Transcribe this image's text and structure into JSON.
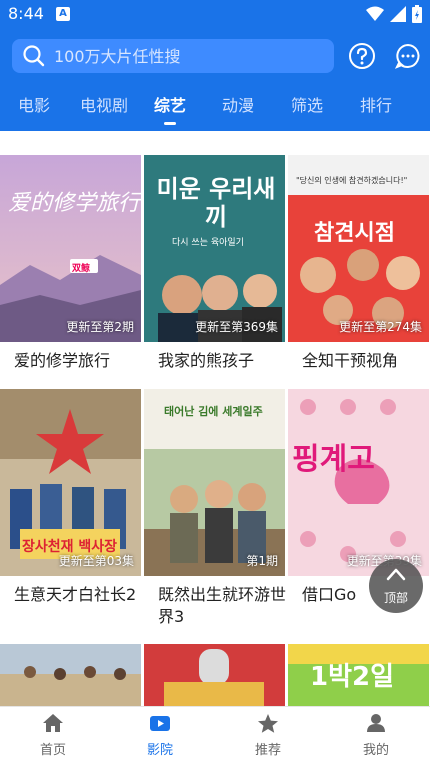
{
  "status": {
    "time": "8:44",
    "notif": "A"
  },
  "search": {
    "placeholder": "100万大片任性搜"
  },
  "tabs": [
    {
      "label": "电影"
    },
    {
      "label": "电视剧"
    },
    {
      "label": "综艺"
    },
    {
      "label": "动漫"
    },
    {
      "label": "筛选"
    },
    {
      "label": "排行"
    }
  ],
  "active_tab": "综艺",
  "cards": [
    {
      "title": "爱的修学旅行",
      "update": "更新至第2期",
      "poster_text": "爱的修学旅行",
      "badge": "双鲸"
    },
    {
      "title": "我家的熊孩子",
      "update": "更新至第369集",
      "poster_text": "미운 우리새끼",
      "poster_sub": "다시 쓰는 육아일기"
    },
    {
      "title": "全知干预视角",
      "update": "更新至第274集",
      "poster_text": "참견시점",
      "poster_sub": "\"당신의 인생에 참견하겠습니다!\""
    },
    {
      "title": "生意天才白社长2",
      "update": "更新至第03集",
      "poster_text": "장사천재 백사장"
    },
    {
      "title": "既然出生就环游世界3",
      "update": "第1期",
      "poster_text": "태어난 김에 세계일주"
    },
    {
      "title": "借口Go",
      "update": "更新至第39集",
      "poster_text": "핑계고"
    },
    {
      "title": "",
      "update": "",
      "poster_text": ""
    },
    {
      "title": "",
      "update": "",
      "poster_text": ""
    },
    {
      "title": "",
      "update": "",
      "poster_text": "1박2일"
    }
  ],
  "top_button": {
    "label": "顶部"
  },
  "bottom_nav": [
    {
      "label": "首页"
    },
    {
      "label": "影院"
    },
    {
      "label": "推荐"
    },
    {
      "label": "我的"
    }
  ],
  "active_nav": "影院",
  "colors": {
    "brand": "#1a73e8",
    "search_bg": "#3e8bff"
  }
}
